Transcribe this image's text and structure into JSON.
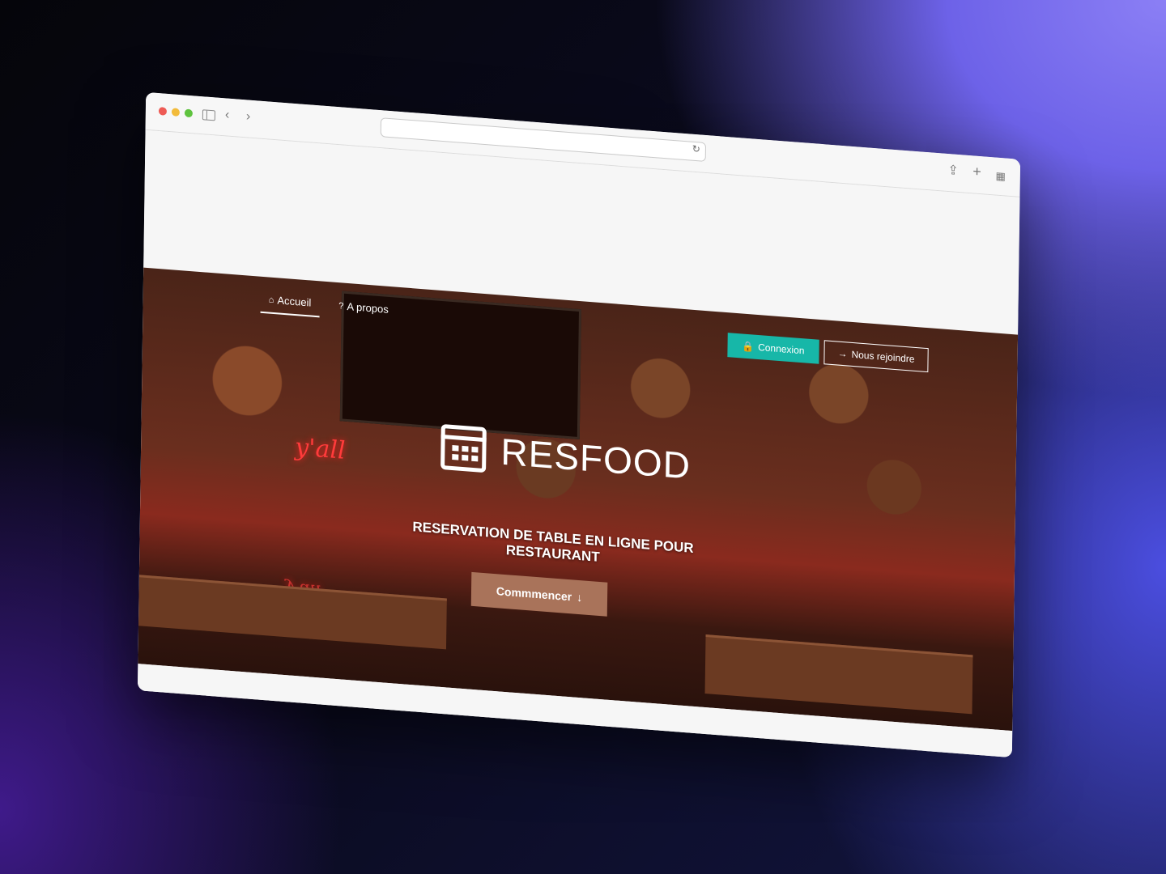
{
  "browser": {
    "url": "",
    "icons": {
      "back": "‹",
      "forward": "›",
      "reload": "↻",
      "share": "⇪",
      "new_tab": "+",
      "tab_overview": "▦"
    }
  },
  "site": {
    "nav": {
      "items": [
        {
          "label": "Accueil",
          "icon": "home-icon",
          "active": true
        },
        {
          "label": "A propos",
          "icon": "help-circle-icon",
          "active": false
        }
      ]
    },
    "auth": {
      "login_label": "Connexion",
      "join_label": "Nous rejoindre"
    },
    "hero": {
      "brand_name": "RESFOOD",
      "tagline": "RESERVATION DE TABLE EN LIGNE POUR RESTAURANT",
      "cta_label": "Commmencer",
      "cta_icon": "↓",
      "neon_sign": "y'all"
    },
    "colors": {
      "login_button": "#17b7a8",
      "cta_button": "#a9735a"
    }
  }
}
